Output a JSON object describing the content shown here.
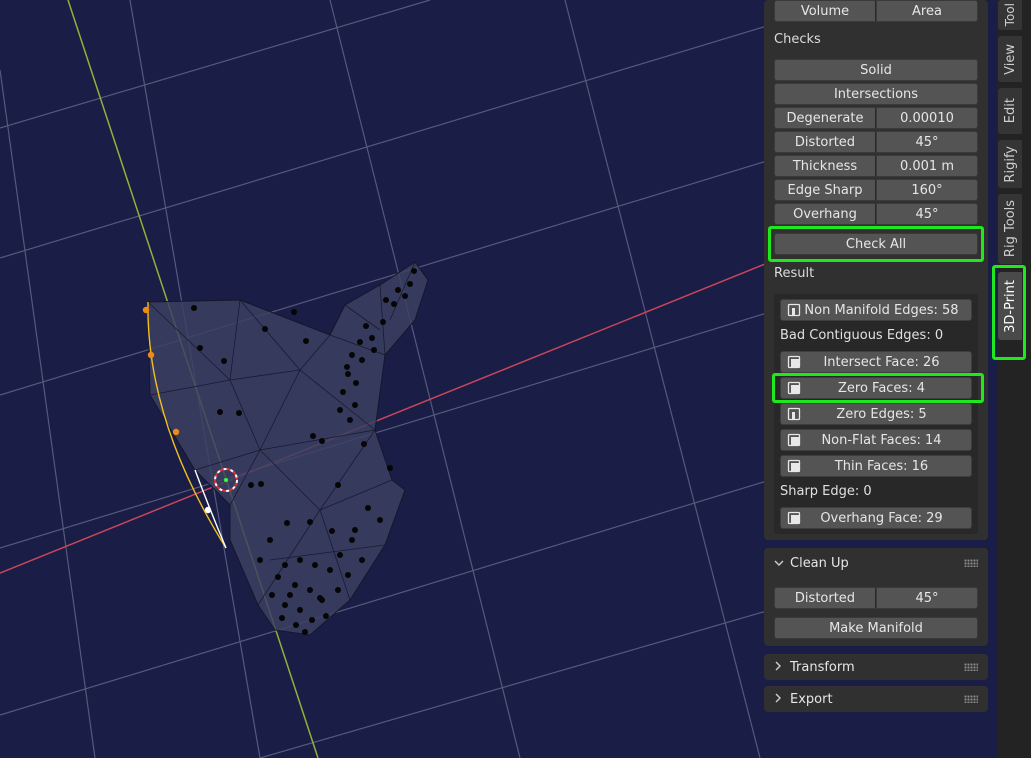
{
  "sidebar": {
    "top_row": [
      "Volume",
      "Area"
    ],
    "checks_label": "Checks",
    "solid_label": "Solid",
    "intersections_label": "Intersections",
    "check_rows": [
      {
        "label": "Degenerate",
        "value": "0.00010"
      },
      {
        "label": "Distorted",
        "value": "45°"
      },
      {
        "label": "Thickness",
        "value": "0.001 m"
      },
      {
        "label": "Edge Sharp",
        "value": "160°"
      },
      {
        "label": "Overhang",
        "value": "45°"
      }
    ],
    "check_all_label": "Check All",
    "result_label": "Result",
    "results": {
      "non_manifold": "Non Manifold Edges: 58",
      "bad_contiguous": "Bad Contiguous Edges: 0",
      "intersect": "Intersect Face: 26",
      "zero_faces": "Zero Faces: 4",
      "zero_edges": "Zero Edges: 5",
      "non_flat": "Non-Flat Faces: 14",
      "thin": "Thin Faces: 16",
      "sharp_edge": "Sharp Edge: 0",
      "overhang": "Overhang Face: 29"
    },
    "cleanup": {
      "title": "Clean Up",
      "distorted_label": "Distorted",
      "distorted_value": "45°",
      "make_manifold_label": "Make Manifold"
    },
    "transform_title": "Transform",
    "export_title": "Export"
  },
  "tabs": [
    "Tool",
    "View",
    "Edit",
    "Rigify",
    "Rig Tools",
    "3D-Print"
  ],
  "active_tab": "3D-Print",
  "colors": {
    "viewport_bg": "#1a1d45",
    "highlight": "#1fe81f",
    "x_axis": "#c8465a",
    "y_axis": "#8fb23a"
  }
}
